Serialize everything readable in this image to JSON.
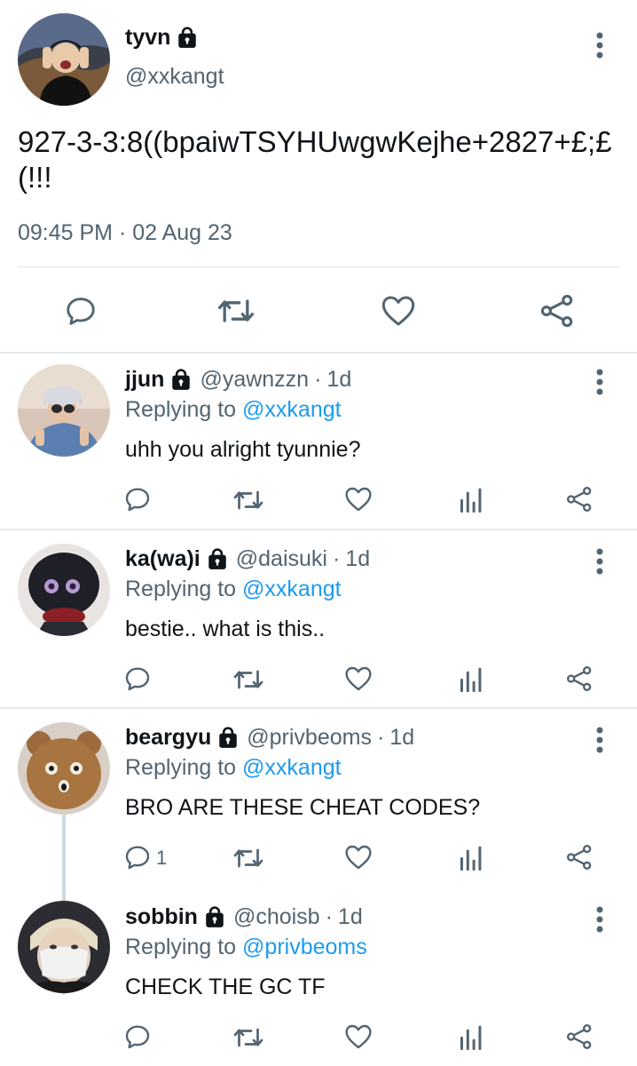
{
  "main_tweet": {
    "name": "tyvn",
    "handle": "@xxkangt",
    "text": "927-3-3:8((bpaiwTSYHUwgwKejhe+2827+£;£(!!!",
    "timestamp": "09:45 PM · 02 Aug 23",
    "icons": [
      "comment-icon",
      "retweet-icon",
      "like-icon",
      "share-icon"
    ]
  },
  "replies": [
    {
      "name": "jjun",
      "handle": "@yawnzzn",
      "age": "1d",
      "replying_prefix": "Replying to",
      "replying_to": "@xxkangt",
      "text": "uhh you alright tyunnie?",
      "reply_count": ""
    },
    {
      "name": "ka(wa)i",
      "handle": "@daisuki",
      "age": "1d",
      "replying_prefix": "Replying to",
      "replying_to": "@xxkangt",
      "text": "bestie.. what is this..",
      "reply_count": ""
    },
    {
      "name": "beargyu",
      "handle": "@privbeoms",
      "age": "1d",
      "replying_prefix": "Replying to",
      "replying_to": "@xxkangt",
      "text": "BRO ARE THESE CHEAT CODES?",
      "reply_count": "1"
    },
    {
      "name": "sobbin",
      "handle": "@choisb",
      "age": "1d",
      "replying_prefix": "Replying to",
      "replying_to": "@privbeoms",
      "text": "CHECK THE GC TF",
      "reply_count": ""
    }
  ],
  "separator": "·",
  "colors": {
    "text": "#0f1419",
    "secondary": "#536471",
    "link": "#1d9bf0",
    "icon": "#536471",
    "divider": "#e6e9ec"
  }
}
